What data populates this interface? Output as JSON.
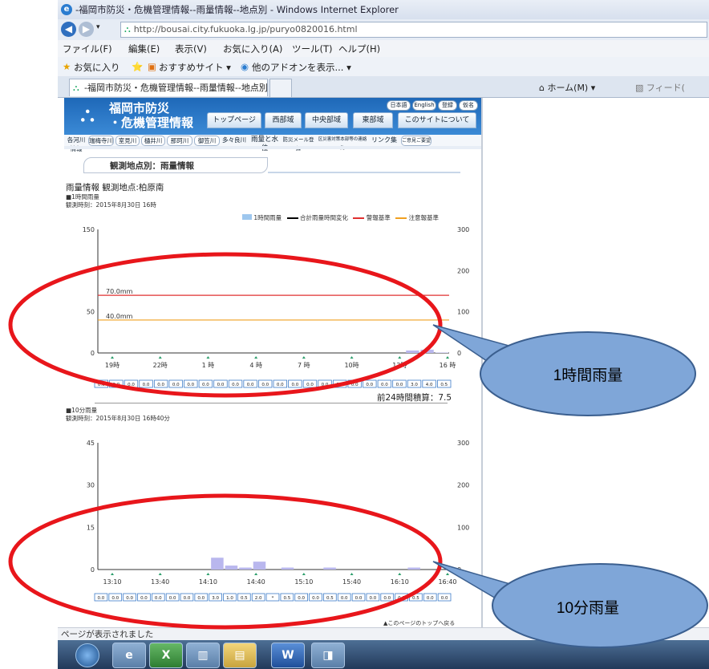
{
  "window": {
    "title": "-福岡市防災・危機管理情報--雨量情報--地点別 - Windows Internet Explorer",
    "url": "http://bousai.city.fukuoka.lg.jp/puryo0820016.html"
  },
  "menu": [
    "ファイル(F)",
    "編集(E)",
    "表示(V)",
    "お気に入り(A)",
    "ツール(T)",
    "ヘルプ(H)"
  ],
  "favorites": {
    "label": "お気に入り",
    "suggested": "おすすめサイト ▾",
    "addons": "他のアドオンを表示... ▾"
  },
  "tab": {
    "title": "-福岡市防災・危機管理情報--雨量情報--地点別",
    "home": "ホーム(M)",
    "feed": "フィード("
  },
  "site": {
    "logo_line1": "福岡市防災",
    "logo_line2": "・危機管理情報",
    "nav": [
      "トップページ",
      "西部域",
      "中央部域",
      "東部域",
      "このサイトについて"
    ],
    "lang": [
      "日本語",
      "English",
      "登録",
      "仮名"
    ],
    "subnav": [
      "各河川情報",
      "瑞梅寺川",
      "室見川",
      "樋井川",
      "那珂川",
      "御笠川",
      "多々良川",
      "雨量と水位",
      "防災メール登録",
      "区災害対策本部等の連絡先",
      "リンク集",
      "ご意見ご要望"
    ],
    "section": "観測地点別：雨量情報",
    "info_title": "雨量情報 観測地点:柏原南",
    "chart1_label": "■1時間雨量",
    "chart1_time": "観測時刻：2015年8月30日 16時",
    "chart2_label": "■10分雨量",
    "chart2_time": "観測時刻：2015年8月30日 16時40分",
    "legend": [
      "1時間雨量",
      "合計雨量時間変化",
      "警報基準",
      "注意報基準"
    ],
    "total24": "前24時間積算：7.5",
    "back_to_top": "▲このページのトップへ戻る"
  },
  "chart_data": [
    {
      "type": "bar",
      "title": "■1時間雨量",
      "series": [
        {
          "name": "1時間雨量",
          "values": [
            0.0,
            0.0,
            0.0,
            0.0,
            0.0,
            0.0,
            0.0,
            0.0,
            0.0,
            0.0,
            0.0,
            0.0,
            0.0,
            0.0,
            0.0,
            0.0,
            0.0,
            0.0,
            0.0,
            0.0,
            0.0,
            3.0,
            4.0,
            0.5
          ]
        }
      ],
      "x_tick_labels": [
        "19時",
        "22時",
        "1 時",
        "4 時",
        "7 時",
        "10時",
        "13時",
        "16 時"
      ],
      "ylim_left": [
        0,
        150
      ],
      "yticks_left": [
        0,
        50,
        150
      ],
      "ylim_right": [
        0,
        300
      ],
      "yticks_right": [
        0,
        100,
        200,
        300
      ],
      "reference_lines": [
        {
          "label": "70.0mm",
          "value": 70,
          "color": "#e03030"
        },
        {
          "label": "40.0mm",
          "value": 40,
          "color": "#f0a020"
        }
      ],
      "value_row": [
        "0.0",
        "0.0",
        "0.0",
        "0.0",
        "0.0",
        "0.0",
        "0.0",
        "0.0",
        "0.0",
        "0.0",
        "0.0",
        "0.0",
        "0.0",
        "0.0",
        "0.0",
        "0.0",
        "0.0",
        "0.0",
        "0.0",
        "0.0",
        "0.0",
        "3.0",
        "4.0",
        "0.5"
      ]
    },
    {
      "type": "bar",
      "title": "■10分雨量",
      "series": [
        {
          "name": "10分雨量",
          "values": [
            0.0,
            0.0,
            0.0,
            0.0,
            0.0,
            0.0,
            0.0,
            0.0,
            3.0,
            1.0,
            0.5,
            2.0,
            0,
            0.5,
            0.0,
            0.0,
            0.5,
            0.0,
            0.0,
            0.0,
            0.0,
            0.0,
            0.5,
            0.0,
            0.0
          ]
        }
      ],
      "x_tick_labels": [
        "13:10",
        "13:40",
        "14:10",
        "14:40",
        "15:10",
        "15:40",
        "16:10",
        "16:40"
      ],
      "ylim_left": [
        0,
        45
      ],
      "yticks_left": [
        0,
        15,
        30,
        45
      ],
      "ylim_right": [
        0,
        300
      ],
      "yticks_right": [
        0,
        100,
        200,
        300
      ],
      "value_row": [
        "0.0",
        "0.0",
        "0.0",
        "0.0",
        "0.0",
        "0.0",
        "0.0",
        "0.0",
        "3.0",
        "1.0",
        "0.5",
        "2.0",
        "*",
        "0.5",
        "0.0",
        "0.0",
        "0.5",
        "0.0",
        "0.0",
        "0.0",
        "0.0",
        "0.0",
        "0.5",
        "0.0",
        "0.0"
      ]
    }
  ],
  "callouts": [
    "1時間雨量",
    "10分雨量"
  ],
  "status": "ページが表示されました",
  "colors": {
    "ellipse": "#e8161b",
    "callout": "#7fa6d8",
    "bar": "#b9b7ee",
    "warn": "#e03030",
    "caution": "#f0a020"
  }
}
